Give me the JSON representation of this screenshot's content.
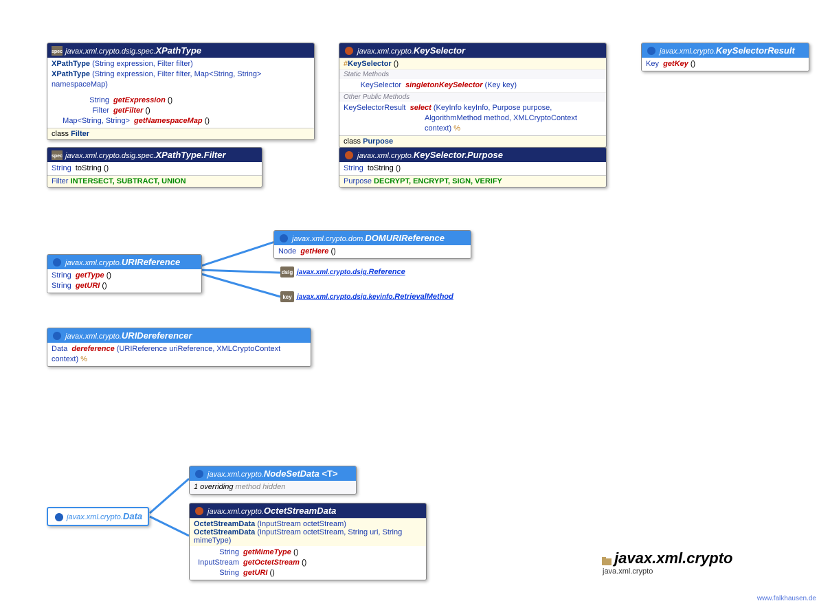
{
  "xpathtype": {
    "pkg": "javax.xml.crypto.dsig.spec.",
    "name": "XPathType",
    "ctor1_name": "XPathType",
    "ctor1_sig": " (String expression, Filter filter)",
    "ctor2_name": "XPathType",
    "ctor2_sig": " (String expression, Filter filter, Map<String, String> namespaceMap)",
    "m1_ret": "String",
    "m1_name": "getExpression",
    "m1_sig": " ()",
    "m2_ret": "Filter",
    "m2_name": "getFilter",
    "m2_sig": " ()",
    "m3_ret": "Map<String, String>",
    "m3_name": "getNamespaceMap",
    "m3_sig": " ()",
    "inner_label": "class ",
    "inner_name": "Filter"
  },
  "xpathfilter": {
    "pkg": "javax.xml.crypto.dsig.spec.",
    "name": "XPathType.Filter",
    "m1_ret": "String",
    "m1_name": "toString",
    "m1_sig": " ()",
    "const_type": "Filter",
    "const_vals": " INTERSECT, SUBTRACT, UNION"
  },
  "keyselector": {
    "pkg": "javax.xml.crypto.",
    "name": "KeySelector",
    "ctor_prefix": "#",
    "ctor_name": "KeySelector",
    "ctor_sig": " ()",
    "sec1": "Static Methods",
    "s1_ret": "KeySelector",
    "s1_name": "singletonKeySelector",
    "s1_sig": " (Key key)",
    "sec2": "Other Public Methods",
    "p1_ret": "KeySelectorResult",
    "p1_name": "select",
    "p1_sig_a": " (KeyInfo keyInfo, Purpose purpose,",
    "p1_sig_b": "AlgorithmMethod method, XMLCryptoContext context) ",
    "p1_throws": "%",
    "inner_label": "class ",
    "inner_name": "Purpose"
  },
  "purpose": {
    "pkg": "javax.xml.crypto.",
    "name": "KeySelector.Purpose",
    "m1_ret": "String",
    "m1_name": "toString",
    "m1_sig": " ()",
    "const_type": "Purpose",
    "const_vals": " DECRYPT, ENCRYPT, SIGN, VERIFY"
  },
  "keyselresult": {
    "pkg": "javax.xml.crypto.",
    "name": "KeySelectorResult",
    "m1_ret": "Key",
    "m1_name": "getKey",
    "m1_sig": " ()"
  },
  "uriref": {
    "pkg": "javax.xml.crypto.",
    "name": "URIReference",
    "m1_ret": "String",
    "m1_name": "getType",
    "m1_sig": " ()",
    "m2_ret": "String",
    "m2_name": "getURI",
    "m2_sig": " ()"
  },
  "domuriref": {
    "pkg": "javax.xml.crypto.dom.",
    "name": "DOMURIReference",
    "m1_ret": "Node",
    "m1_name": "getHere",
    "m1_sig": " ()"
  },
  "ref_dsig": {
    "badge": "dsig",
    "pkg": "javax.xml.crypto.dsig.",
    "name": "Reference"
  },
  "ref_key": {
    "badge": "key",
    "pkg": "javax.xml.crypto.dsig.keyinfo.",
    "name": "RetrievalMethod"
  },
  "urideref": {
    "pkg": "javax.xml.crypto.",
    "name": "URIDereferencer",
    "m1_ret": "Data",
    "m1_name": "dereference",
    "m1_sig": " (URIReference uriReference, XMLCryptoContext context) ",
    "m1_throws": "%"
  },
  "data": {
    "pkg": "javax.xml.crypto.",
    "name": "Data"
  },
  "nodesetdata": {
    "pkg": "javax.xml.crypto.",
    "name": "NodeSetData",
    "generic": " <T>",
    "note_a": "1 overriding",
    "note_b": " method hidden"
  },
  "octet": {
    "pkg": "javax.xml.crypto.",
    "name": "OctetStreamData",
    "ctor1_name": "OctetStreamData",
    "ctor1_sig": " (InputStream octetStream)",
    "ctor2_name": "OctetStreamData",
    "ctor2_sig": " (InputStream octetStream, String uri, String mimeType)",
    "m1_ret": "String",
    "m1_name": "getMimeType",
    "m1_sig": " ()",
    "m2_ret": "InputStream",
    "m2_name": "getOctetStream",
    "m2_sig": " ()",
    "m3_ret": "String",
    "m3_name": "getURI",
    "m3_sig": " ()"
  },
  "title": {
    "main": "javax.xml.crypto",
    "sub": "java.xml.crypto"
  },
  "watermark": "www.falkhausen.de",
  "icons": {
    "spec": "spec"
  }
}
